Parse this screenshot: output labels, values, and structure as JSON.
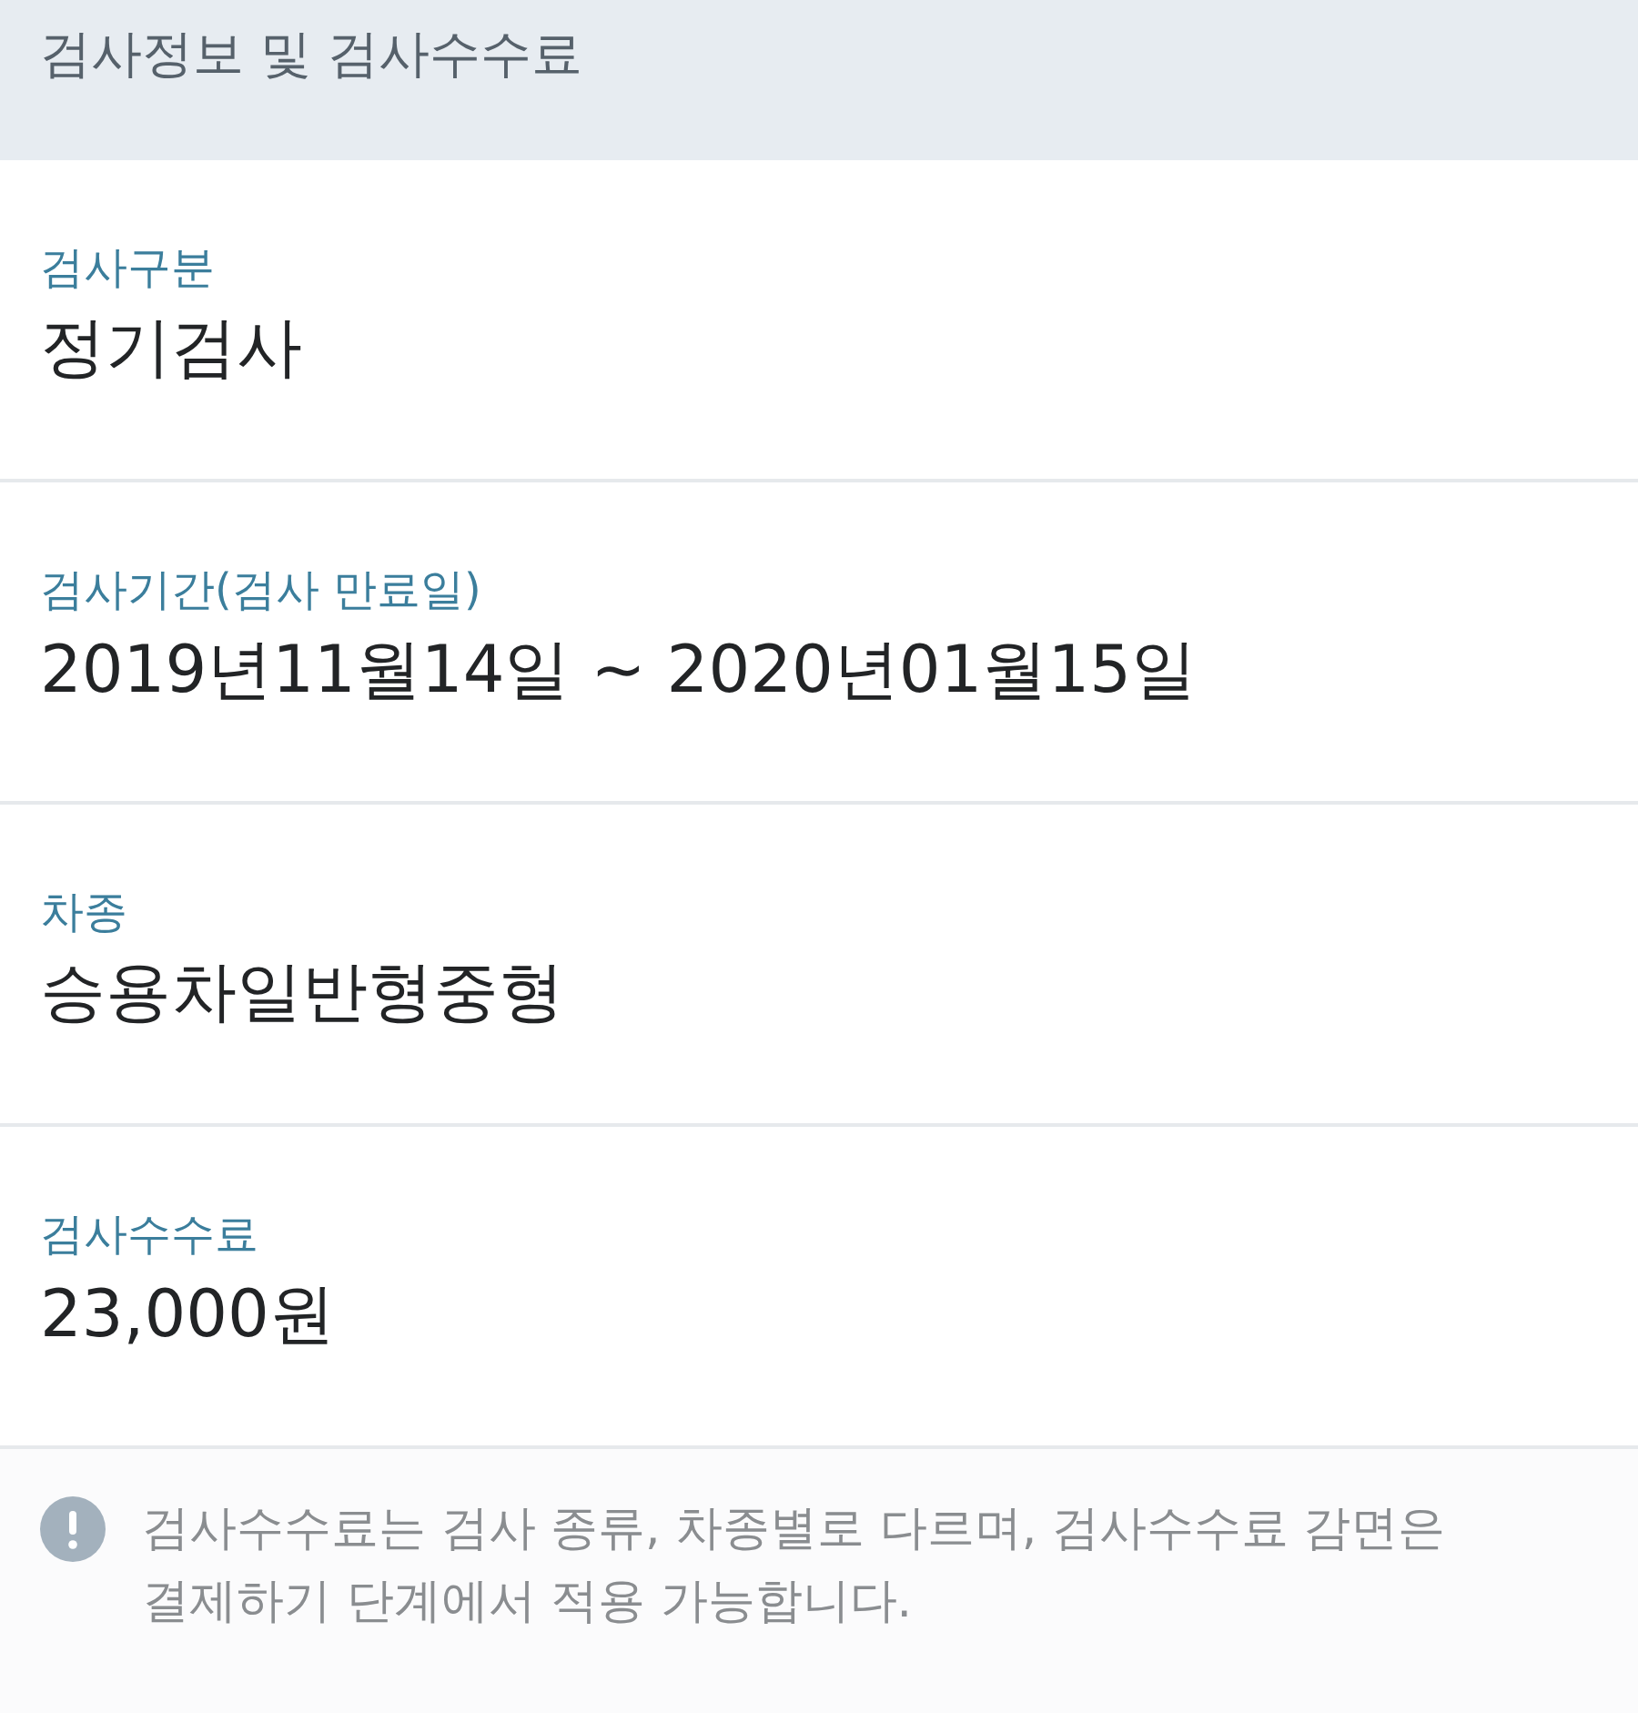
{
  "header": {
    "title": "검사정보 및 검사수수료"
  },
  "fields": [
    {
      "label": "검사구분",
      "value": "정기검사"
    },
    {
      "label": "검사기간(검사 만료일)",
      "value": "2019년11월14일 ~ 2020년01월15일"
    },
    {
      "label": "차종",
      "value": "승용차일반형중형"
    },
    {
      "label": "검사수수료",
      "value": "23,000원"
    }
  ],
  "notice": {
    "text": "검사수수료는 검사 종류, 차종별로 다르며, 검사수수료 감면은 결제하기 단계에서 적용 가능합니다."
  }
}
